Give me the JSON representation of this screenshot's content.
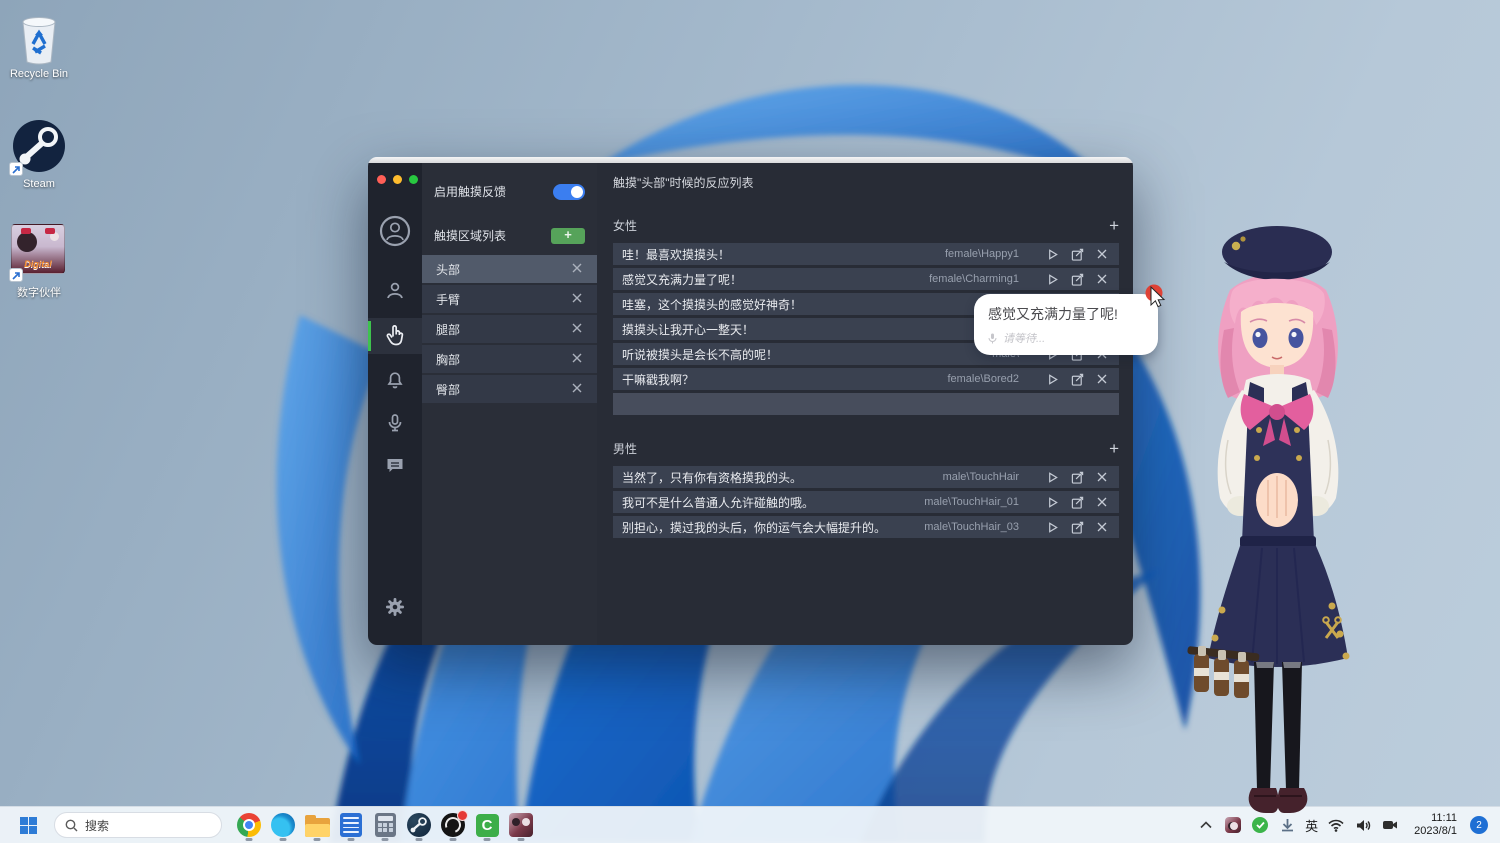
{
  "desktop": {
    "icons": [
      {
        "label": "Recycle Bin"
      },
      {
        "label": "Steam"
      },
      {
        "label": "数字伙伴"
      }
    ]
  },
  "app_window": {
    "panel": {
      "enable_label": "启用触摸反馈",
      "area_list_label": "触摸区域列表",
      "add_label": "+",
      "areas": [
        {
          "label": "头部"
        },
        {
          "label": "手臂"
        },
        {
          "label": "腿部"
        },
        {
          "label": "胸部"
        },
        {
          "label": "臀部"
        }
      ]
    },
    "main": {
      "title": "触摸\"头部\"时候的反应列表",
      "groups": [
        {
          "name": "女性",
          "add_label": "+",
          "rows": [
            {
              "text": "哇！最喜欢摸摸头！",
              "file": "female\\Happy1"
            },
            {
              "text": "感觉又充满力量了呢！",
              "file": "female\\Charming1"
            },
            {
              "text": "哇塞，这个摸摸头的感觉好神奇！",
              "file": ""
            },
            {
              "text": "摸摸头让我开心一整天！",
              "file": ""
            },
            {
              "text": "听说被摸头是会长不高的呢！",
              "file": "male\\"
            },
            {
              "text": "干嘛戳我啊？",
              "file": "female\\Bored2"
            }
          ]
        },
        {
          "name": "男性",
          "add_label": "+",
          "rows": [
            {
              "text": "当然了，只有你有资格摸我的头。",
              "file": "male\\TouchHair"
            },
            {
              "text": "我可不是什么普通人允许碰触的哦。",
              "file": "male\\TouchHair_01"
            },
            {
              "text": "别担心，摸过我的头后，你的运气会大幅提升的。",
              "file": "male\\TouchHair_03"
            }
          ]
        }
      ]
    }
  },
  "speech_bubble": {
    "text": "感觉又充满力量了呢!",
    "sub": "请等待..."
  },
  "taskbar": {
    "search_placeholder": "搜索",
    "ime": "英",
    "time": "11:11",
    "date": "2023/8/1",
    "badge": "2"
  },
  "colors": {
    "accent_blue": "#3b7ef0",
    "accent_green": "#56a35a",
    "selected_item": "#515a6a",
    "window_bg": "#282c36"
  }
}
